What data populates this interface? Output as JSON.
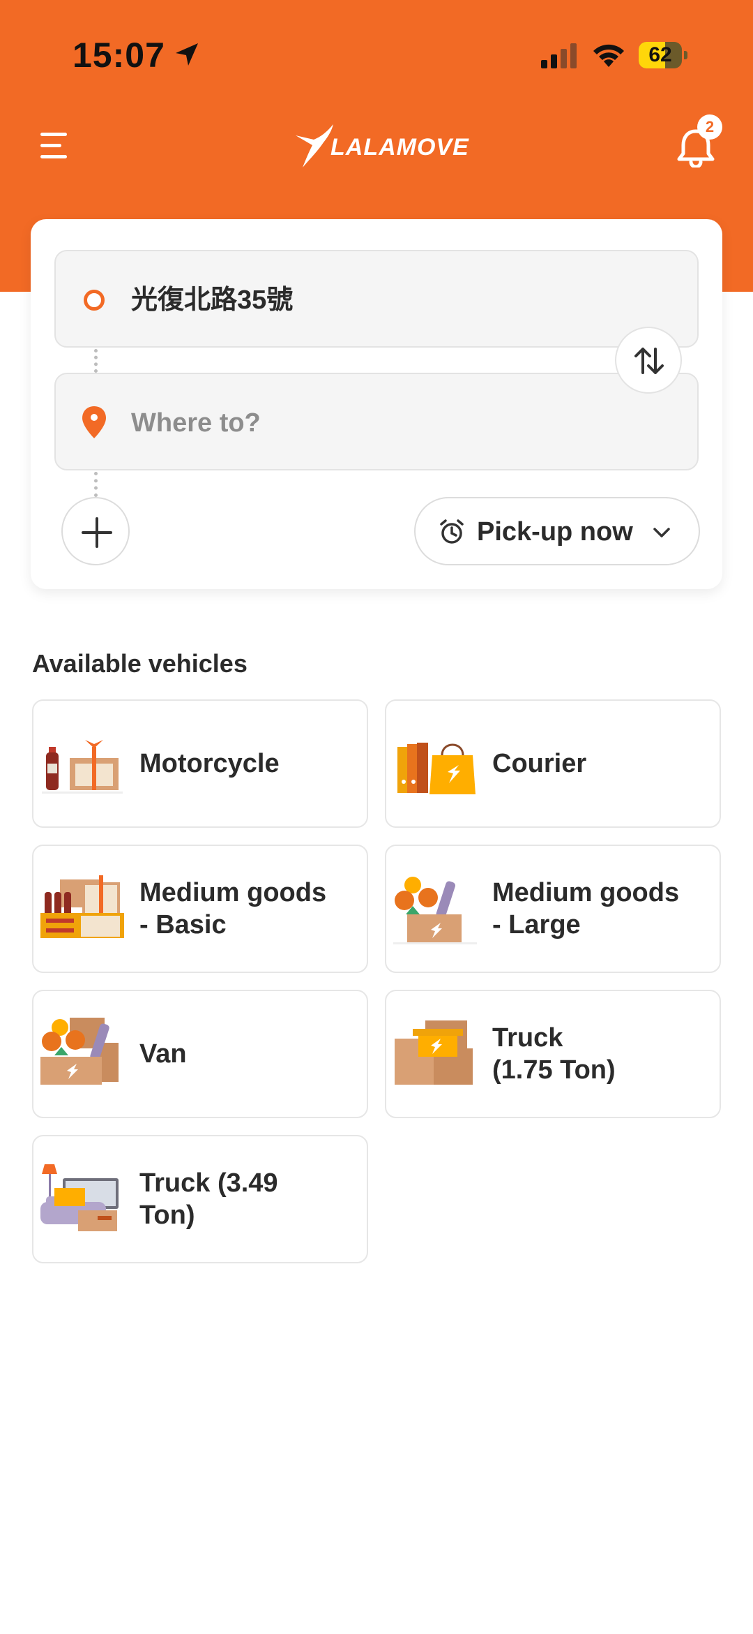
{
  "status_bar": {
    "time": "15:07",
    "battery_percent": "62",
    "battery_level": 0.62
  },
  "header": {
    "brand": "LALAMOVE",
    "notification_count": "2"
  },
  "route": {
    "pickup_address": "光復北路35號",
    "dropoff_placeholder": "Where to?",
    "pickup_time_label": "Pick-up now"
  },
  "vehicles": {
    "title": "Available vehicles",
    "items": [
      {
        "label": "Motorcycle"
      },
      {
        "label": "Courier"
      },
      {
        "label": "Medium goods\n- Basic"
      },
      {
        "label": "Medium goods\n- Large"
      },
      {
        "label": "Van"
      },
      {
        "label": "Truck\n(1.75 Ton)"
      },
      {
        "label": "Truck (3.49\nTon)"
      }
    ]
  },
  "colors": {
    "brand_orange": "#f26a25",
    "battery_yellow": "#ffd60a"
  }
}
